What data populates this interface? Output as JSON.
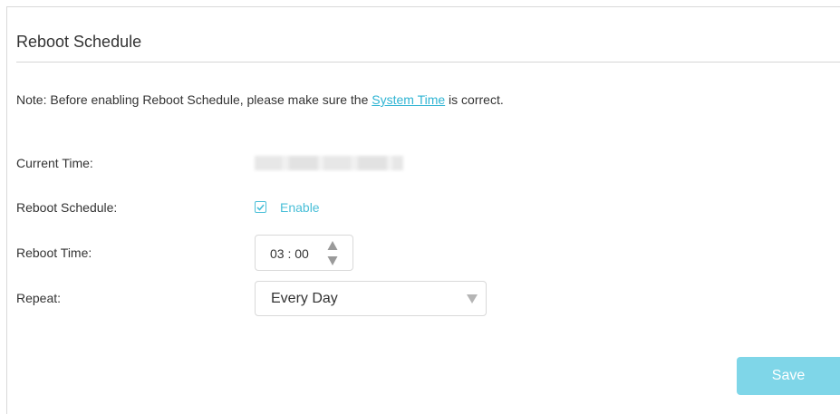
{
  "section": {
    "title": "Reboot Schedule"
  },
  "note": {
    "prefix": "Note: Before enabling Reboot Schedule, please make sure the ",
    "link": "System Time",
    "suffix": " is correct."
  },
  "fields": {
    "current_time_label": "Current Time:",
    "reboot_schedule_label": "Reboot Schedule:",
    "enable_label": "Enable",
    "enable_checked": true,
    "reboot_time_label": "Reboot Time:",
    "reboot_time_value": "03 : 00",
    "repeat_label": "Repeat:",
    "repeat_value": "Every Day"
  },
  "actions": {
    "save_label": "Save"
  },
  "colors": {
    "accent": "#4abfd8",
    "button": "#7fd6e8",
    "link": "#2fb4d3"
  }
}
